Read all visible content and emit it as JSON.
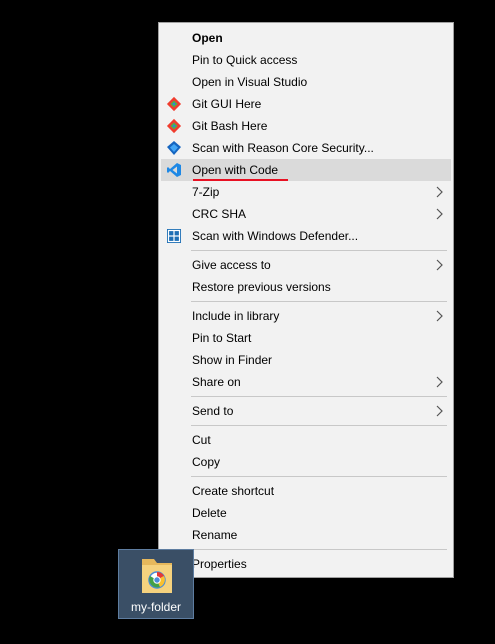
{
  "context_menu": {
    "items": [
      {
        "label": "Open"
      },
      {
        "label": "Pin to Quick access"
      },
      {
        "label": "Open in Visual Studio"
      },
      {
        "label": "Git GUI Here",
        "icon": "git-icon"
      },
      {
        "label": "Git Bash Here",
        "icon": "git-icon"
      },
      {
        "label": "Scan with Reason Core Security...",
        "icon": "reason-security-icon"
      },
      {
        "label": "Open with Code",
        "icon": "vscode-icon",
        "highlighted": true
      },
      {
        "label": "7-Zip",
        "submenu": true
      },
      {
        "label": "CRC SHA",
        "submenu": true
      },
      {
        "label": "Scan with Windows Defender...",
        "icon": "windows-defender-icon"
      },
      {
        "label": "Give access to",
        "submenu": true
      },
      {
        "label": "Restore previous versions"
      },
      {
        "label": "Include in library",
        "submenu": true
      },
      {
        "label": "Pin to Start"
      },
      {
        "label": "Show in Finder"
      },
      {
        "label": "Share on",
        "submenu": true
      },
      {
        "label": "Send to",
        "submenu": true
      },
      {
        "label": "Cut"
      },
      {
        "label": "Copy"
      },
      {
        "label": "Create shortcut"
      },
      {
        "label": "Delete"
      },
      {
        "label": "Rename"
      },
      {
        "label": "Properties"
      }
    ]
  },
  "desktop": {
    "folder_label": "my-folder"
  },
  "colors": {
    "menu_background": "#f2f2f2",
    "highlight": "#dadada",
    "annotation_underline": "#e81123",
    "desktop_background": "#000000",
    "selected_folder_background": "#3a4f66"
  }
}
